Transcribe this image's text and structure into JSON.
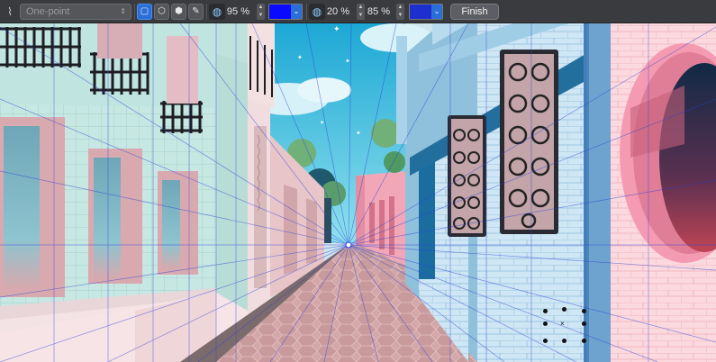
{
  "toolbar": {
    "mode_select": {
      "value": "One-point"
    },
    "line_opacity": "95 %",
    "grid_opacity_a": "20 %",
    "grid_opacity_b": "85 %",
    "finish_label": "Finish",
    "colors": {
      "line": "#0a0aff",
      "grid": "#1e2fd0",
      "accent": "#2a6fd8"
    }
  },
  "canvas": {
    "perspective": "one-point",
    "vanishing_point_color": "#ffffff"
  },
  "icons": [
    "perspective-tool-icon",
    "chevron-down-icon",
    "square-grid-icon",
    "cube-outline-icon",
    "cube-solid-icon",
    "pen-icon",
    "opacity-icon",
    "up-down-stepper-icon"
  ]
}
